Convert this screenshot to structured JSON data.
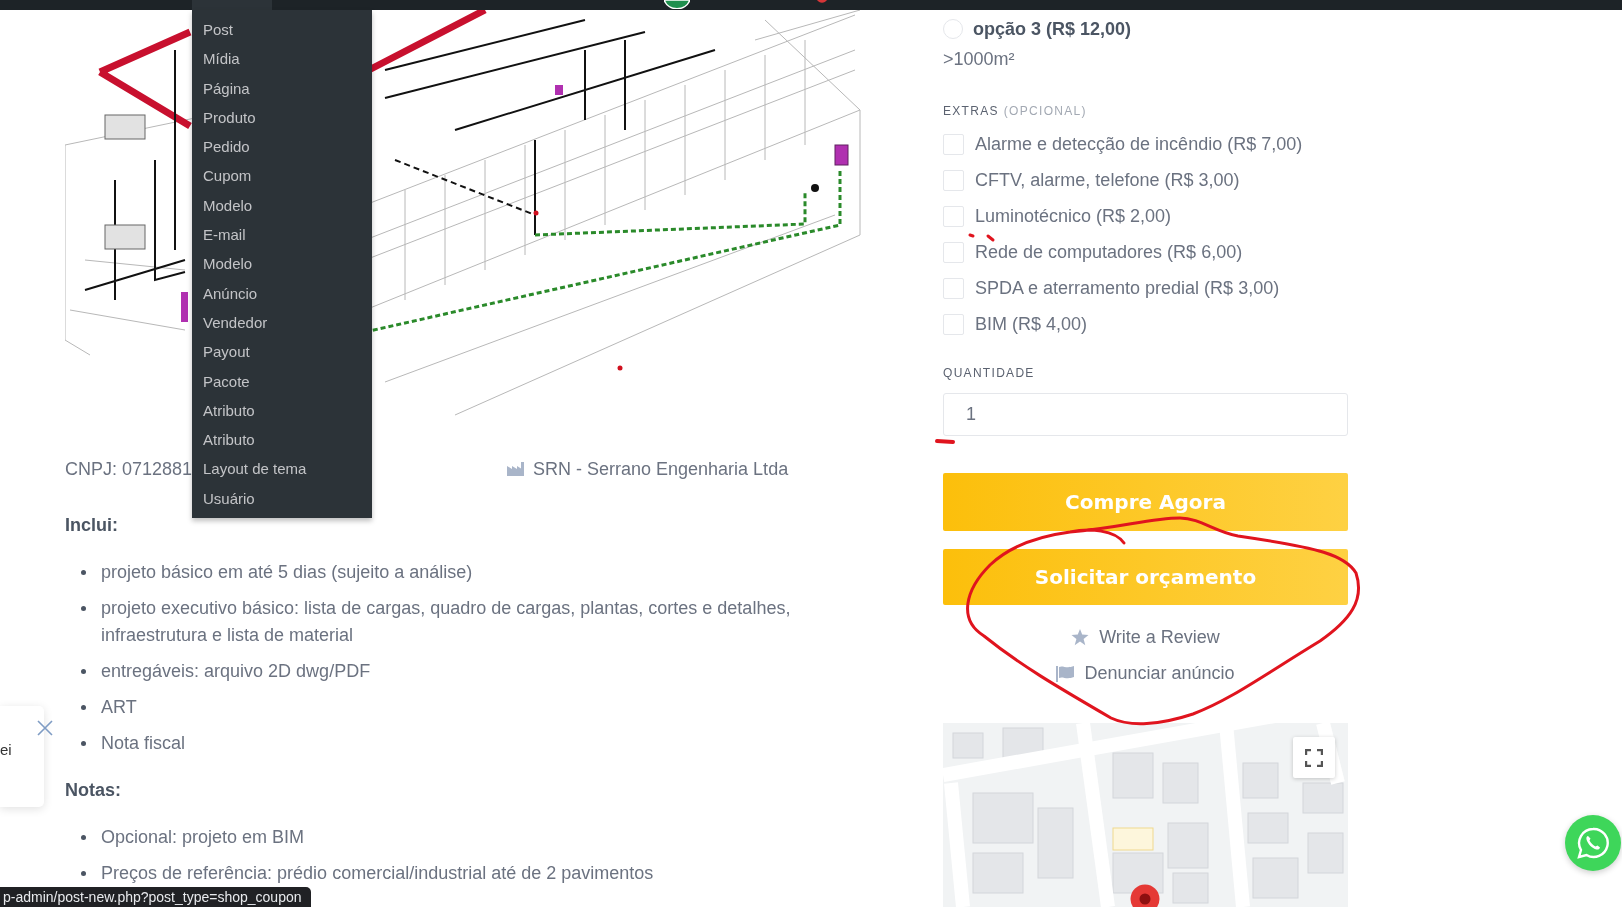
{
  "admin_menu": {
    "items": [
      "Post",
      "Mídia",
      "Página",
      "Produto",
      "Pedido",
      "Cupom",
      "Modelo",
      "E-mail",
      "Modelo",
      "Anúncio",
      "Vendedor",
      "Payout",
      "Pacote",
      "Atributo",
      "Atributo",
      "Layout de tema",
      "Usuário"
    ]
  },
  "product": {
    "cnpj": "CNPJ: 0712881",
    "seller": "SRN - Serrano Engenharia Ltda"
  },
  "description": {
    "sections": [
      {
        "heading": "Inclui:",
        "items": [
          "projeto básico em até 5 dias (sujeito a análise)",
          "projeto executivo básico: lista de cargas, quadro de cargas, plantas, cortes e detalhes, infraestrutura e lista de material",
          "entregáveis: arquivo 2D dwg/PDF",
          "ART",
          "Nota fiscal"
        ]
      },
      {
        "heading": "Notas:",
        "items": [
          "Opcional: projeto em BIM",
          "Preços de referência: prédio comercial/industrial até de 2 pavimentos"
        ]
      }
    ]
  },
  "option": {
    "label": "opção 3 (R$ 12,00)",
    "selected": false,
    "note": ">1000m²"
  },
  "extras": {
    "label": "EXTRAS",
    "hint": "(OPCIONAL)",
    "items": [
      {
        "label": "Alarme e detecção de incêndio (R$ 7,00)",
        "checked": false
      },
      {
        "label": "CFTV, alarme, telefone (R$ 3,00)",
        "checked": false
      },
      {
        "label": "Luminotécnico (R$ 2,00)",
        "checked": false
      },
      {
        "label": "Rede de computadores (R$ 6,00)",
        "checked": false
      },
      {
        "label": "SPDA e aterramento predial (R$ 3,00)",
        "checked": false
      },
      {
        "label": "BIM (R$ 4,00)",
        "checked": false
      }
    ]
  },
  "quantity": {
    "label": "QUANTIDADE",
    "value": "1"
  },
  "buttons": [
    "Compre Agora",
    "Solicitar orçamento"
  ],
  "links": [
    {
      "kind": "review",
      "label": "Write a Review"
    },
    {
      "kind": "report",
      "label": "Denunciar anúncio"
    }
  ],
  "popup": {
    "text": "ei"
  },
  "status_bar": {
    "url": "p-admin/post-new.php?post_type=shop_coupon"
  }
}
